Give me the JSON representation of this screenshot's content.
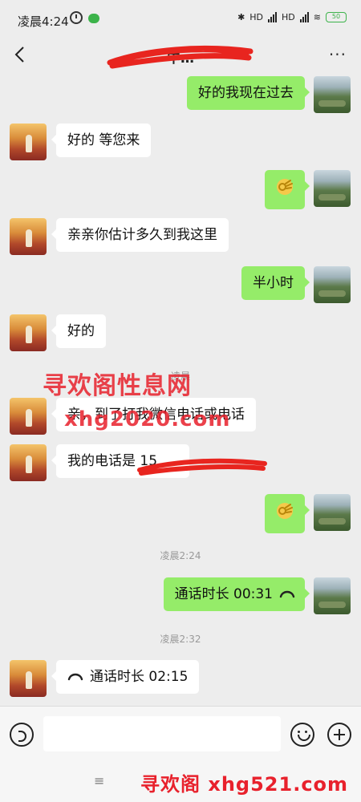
{
  "status_bar": {
    "time": "凌晨4:24",
    "network_1": "HD",
    "network_2": "HD",
    "battery": "50"
  },
  "header": {
    "title": "中…",
    "more": "···"
  },
  "messages": [
    {
      "side": "me",
      "text": "好的我现在过去"
    },
    {
      "side": "them",
      "text": "好的 等您来"
    },
    {
      "side": "me",
      "emoji": "ok-hand"
    },
    {
      "side": "them",
      "text": "亲亲你估计多久到我这里"
    },
    {
      "side": "me",
      "text": "半小时"
    },
    {
      "side": "them",
      "text": "好的"
    },
    {
      "side": "system",
      "text": "凌晨"
    },
    {
      "side": "them",
      "text": "亲，到了打我微信电话或电话"
    },
    {
      "side": "them",
      "text": "我的电话是 15"
    },
    {
      "side": "me",
      "emoji": "ok-hand"
    },
    {
      "side": "system",
      "text": "凌晨2:24"
    },
    {
      "side": "me",
      "text": "通话时长 00:31"
    },
    {
      "side": "system",
      "text": "凌晨2:32"
    },
    {
      "side": "them",
      "text": "通话时长 02:15"
    }
  ],
  "watermarks": {
    "top_line_1": "寻欢阁性息网",
    "top_line_2": "xhg2020.com",
    "bottom": "寻欢阁 xhg521.com"
  },
  "nav": {
    "menu": "≡"
  },
  "colors": {
    "my_bubble": "#95ec69",
    "their_bubble": "#ffffff",
    "background": "#ededed",
    "watermark": "#e8212c"
  }
}
